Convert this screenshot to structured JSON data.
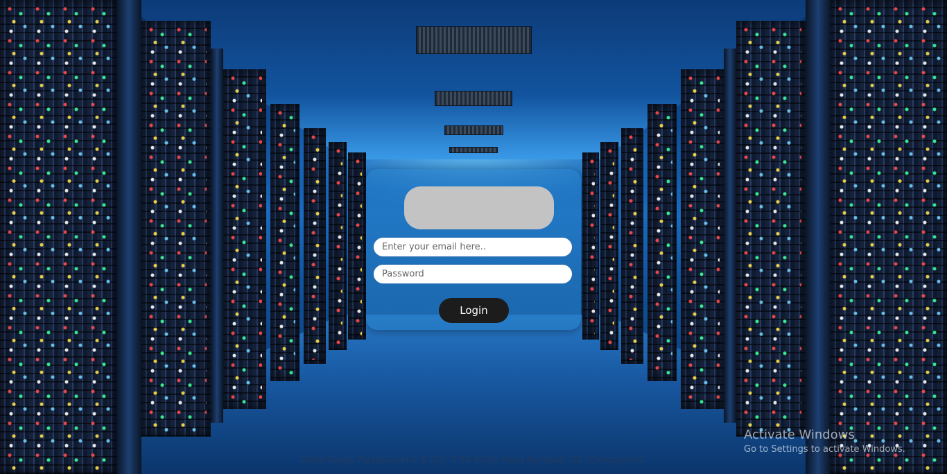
{
  "login": {
    "email_placeholder": "Enter your email here..",
    "password_placeholder": "Password",
    "button_label": "Login"
  },
  "footer": {
    "address": "Atlas Rangs Plaza(Level-9 & 10), 7 SK Mujib Road Agrabad C/A, Chottogram."
  },
  "watermark": {
    "title": "Activate Windows",
    "subtitle": "Go to Settings to activate Windows."
  },
  "colors": {
    "panel": "#2882c8",
    "button": "#1c1c1c",
    "logo_placeholder": "#c3c3c3"
  }
}
